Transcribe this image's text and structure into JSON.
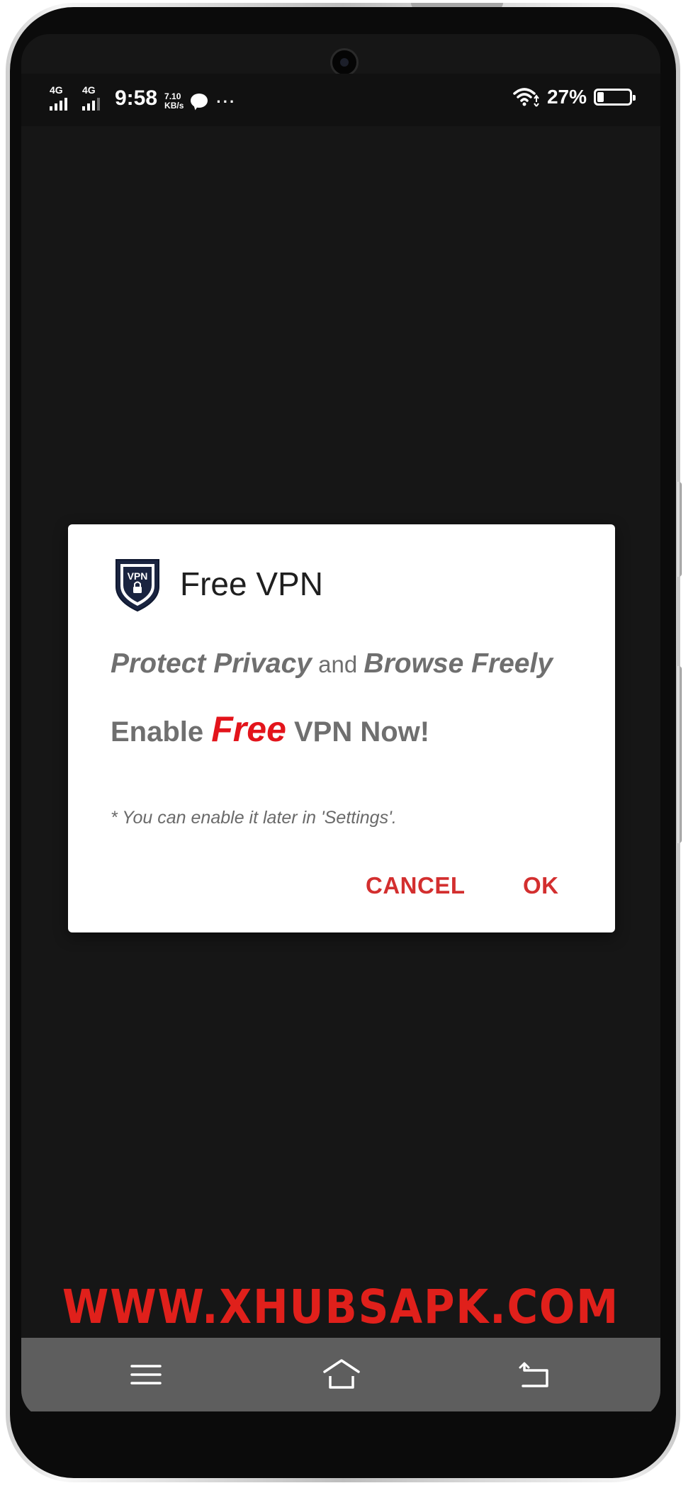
{
  "status_bar": {
    "network_1": "4G",
    "network_2": "4G",
    "time": "9:58",
    "speed_value": "7.10",
    "speed_unit": "KB/s",
    "more": "···",
    "battery_percent": "27%",
    "battery_level": 0.27,
    "icons": [
      "signal-icon",
      "chat-icon",
      "more-icon",
      "wifi-icon",
      "battery-icon"
    ]
  },
  "dialog": {
    "icon": "shield-vpn-icon",
    "icon_label": "VPN",
    "title": "Free VPN",
    "line1": {
      "part1": "Protect Privacy",
      "part2": " and ",
      "part3": "Browse Freely"
    },
    "line2": {
      "part1": "Enable ",
      "part2": "Free",
      "part3": " VPN Now!"
    },
    "note": "* You can enable it later in 'Settings'.",
    "cancel_label": "CANCEL",
    "ok_label": "OK",
    "accent_color": "#d32f2f"
  },
  "watermark": "WWW.XHUBSAPK.COM",
  "nav_bar": {
    "icons": [
      "menu-icon",
      "home-icon",
      "back-icon"
    ]
  }
}
